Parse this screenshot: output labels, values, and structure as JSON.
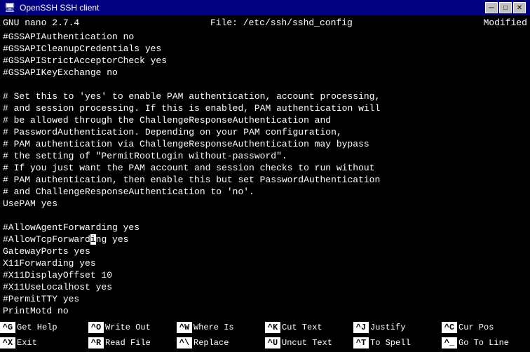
{
  "titlebar": {
    "title": "OpenSSH SSH client",
    "icon": "🖥",
    "minimize": "─",
    "maximize": "□",
    "close": "✕"
  },
  "nanoheader": {
    "left": "GNU nano 2.7.4",
    "center": "File: /etc/ssh/sshd_config",
    "right": "Modified"
  },
  "editor": {
    "lines": [
      "#GSSAPIAuthentication no",
      "#GSSAPICleanupCredentials yes",
      "#GSSAPIStrictAcceptorCheck yes",
      "#GSSAPIKeyExchange no",
      "",
      "# Set this to 'yes' to enable PAM authentication, account processing,",
      "# and session processing. If this is enabled, PAM authentication will",
      "# be allowed through the ChallengeResponseAuthentication and",
      "# PasswordAuthentication. Depending on your PAM configuration,",
      "# PAM authentication via ChallengeResponseAuthentication may bypass",
      "# the setting of \"PermitRootLogin without-password\".",
      "# If you just want the PAM account and session checks to run without",
      "# PAM authentication, then enable this but set PasswordAuthentication",
      "# and ChallengeResponseAuthentication to 'no'.",
      "UsePAM yes",
      "",
      "#AllowAgentForwarding yes",
      "#AllowTcpForwarding yes",
      "GatewayPorts yes",
      "X11Forwarding yes",
      "#X11DisplayOffset 10",
      "#X11UseLocalhost yes",
      "#PermitTTY yes",
      "PrintMotd no"
    ],
    "cursor_line": 18,
    "cursor_col": 16
  },
  "shortcuts": {
    "row1": [
      {
        "key": "^G",
        "label": "Get Help"
      },
      {
        "key": "^O",
        "label": "Write Out"
      },
      {
        "key": "^W",
        "label": "Where Is"
      },
      {
        "key": "^K",
        "label": "Cut Text"
      },
      {
        "key": "^J",
        "label": "Justify"
      },
      {
        "key": "^C",
        "label": "Cur Pos"
      }
    ],
    "row2": [
      {
        "key": "^X",
        "label": "Exit"
      },
      {
        "key": "^R",
        "label": "Read File"
      },
      {
        "key": "^\\",
        "label": "Replace"
      },
      {
        "key": "^U",
        "label": "Uncut Text"
      },
      {
        "key": "^T",
        "label": "To Spell"
      },
      {
        "key": "^_",
        "label": "Go To Line"
      }
    ]
  }
}
